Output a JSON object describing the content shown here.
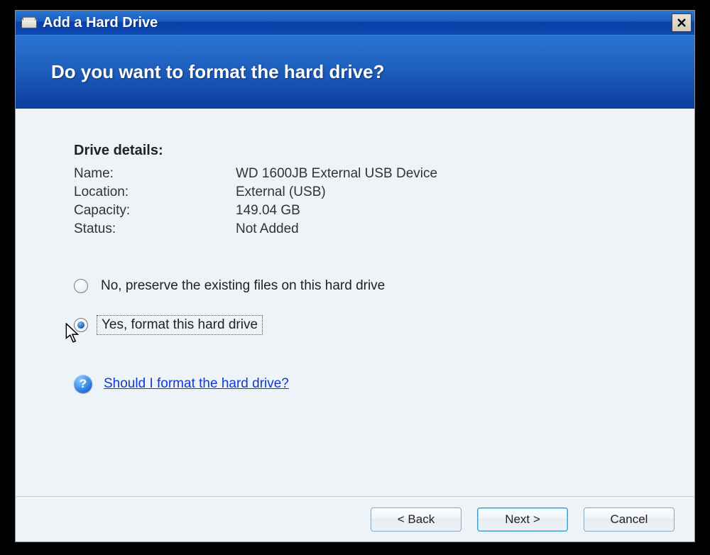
{
  "window": {
    "title": "Add a Hard Drive"
  },
  "header": {
    "heading": "Do you want to format the hard drive?"
  },
  "details": {
    "section_title": "Drive details:",
    "rows": {
      "name_label": "Name:",
      "name_value": "WD 1600JB External USB Device",
      "location_label": "Location:",
      "location_value": "External (USB)",
      "capacity_label": "Capacity:",
      "capacity_value": "149.04 GB",
      "status_label": "Status:",
      "status_value": "Not Added"
    }
  },
  "options": {
    "no_label": "No, preserve the existing files on this hard drive",
    "yes_label": "Yes, format this hard drive",
    "selected": "yes"
  },
  "help": {
    "icon_text": "?",
    "link_text": "Should I format the hard drive?"
  },
  "buttons": {
    "back": "< Back",
    "next": "Next >",
    "cancel": "Cancel"
  }
}
